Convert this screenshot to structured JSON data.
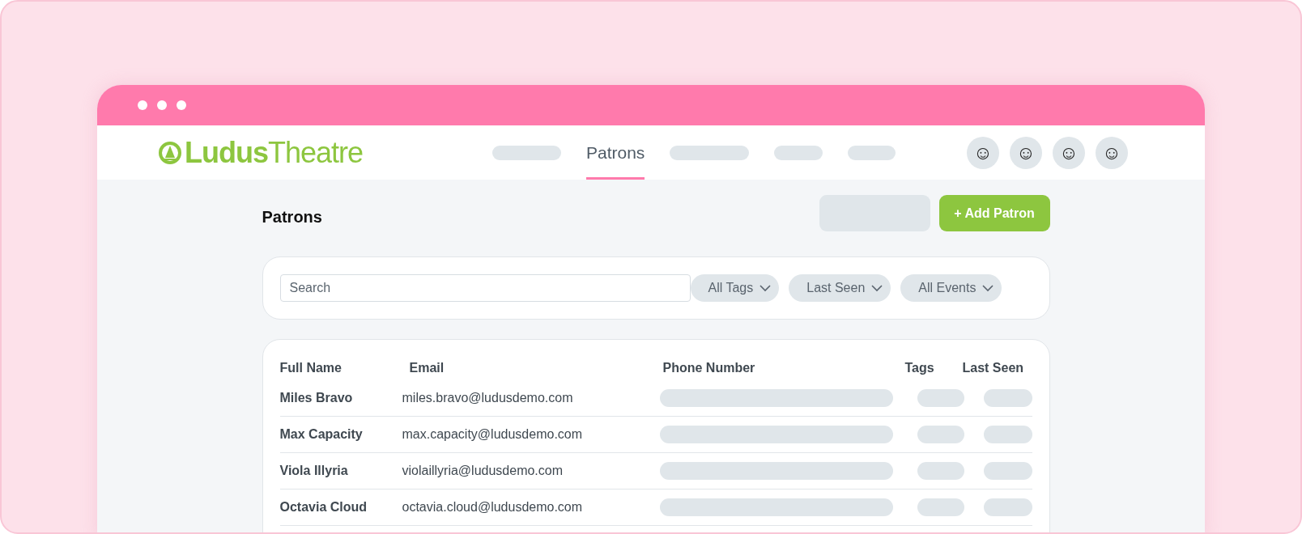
{
  "logo": {
    "bold": "Ludus",
    "light": "Theatre"
  },
  "nav": [
    {
      "kind": "placeholder"
    },
    {
      "kind": "tab",
      "label": "Patrons",
      "selected": true
    },
    {
      "kind": "placeholder"
    },
    {
      "kind": "placeholder"
    },
    {
      "kind": "placeholder"
    }
  ],
  "avatars": [
    "☺",
    "☺",
    "☺",
    "☺"
  ],
  "page_title": "Patrons",
  "add_button": "+ Add Patron",
  "search": {
    "placeholder": "Search"
  },
  "filters": [
    "All Tags",
    "Last Seen",
    "All Events"
  ],
  "table": {
    "columns": [
      "Full Name",
      "Email",
      "Phone Number",
      "Tags",
      "Last Seen"
    ],
    "rows": [
      {
        "name": "Miles Bravo",
        "email": "miles.bravo@ludusdemo.com"
      },
      {
        "name": "Max Capacity",
        "email": "max.capacity@ludusdemo.com"
      },
      {
        "name": "Viola Illyria",
        "email": "violaillyria@ludusdemo.com"
      },
      {
        "name": "Octavia Cloud",
        "email": "octavia.cloud@ludusdemo.com"
      }
    ]
  }
}
